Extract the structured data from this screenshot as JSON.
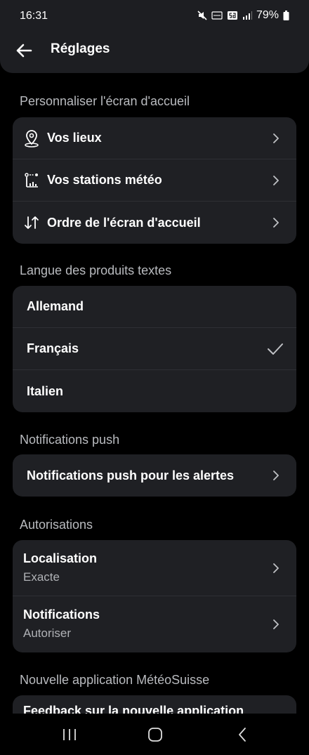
{
  "status": {
    "time": "16:31",
    "battery": "79%"
  },
  "header": {
    "title": "Réglages"
  },
  "sections": {
    "home": {
      "title": "Personnaliser l'écran d'accueil",
      "items": [
        {
          "label": "Vos lieux",
          "icon": "location-pin-icon"
        },
        {
          "label": "Vos stations météo",
          "icon": "weather-station-icon"
        },
        {
          "label": "Ordre de l'écran d'accueil",
          "icon": "sort-order-icon"
        }
      ]
    },
    "language": {
      "title": "Langue des produits textes",
      "items": [
        {
          "label": "Allemand",
          "selected": false
        },
        {
          "label": "Français",
          "selected": true
        },
        {
          "label": "Italien",
          "selected": false
        }
      ]
    },
    "push": {
      "title": "Notifications push",
      "items": [
        {
          "label": "Notifications push pour les alertes"
        }
      ]
    },
    "permissions": {
      "title": "Autorisations",
      "items": [
        {
          "label": "Localisation",
          "value": "Exacte"
        },
        {
          "label": "Notifications",
          "value": "Autoriser"
        }
      ]
    },
    "newapp": {
      "title": "Nouvelle application MétéoSuisse",
      "items": [
        {
          "label": "Feedback sur la nouvelle application"
        }
      ]
    }
  }
}
